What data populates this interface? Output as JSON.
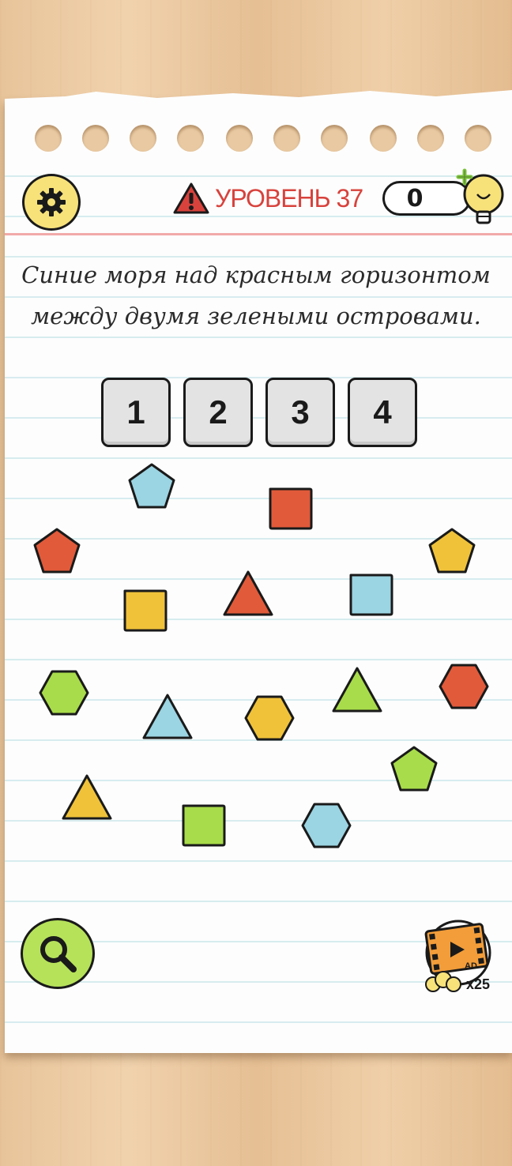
{
  "header": {
    "level_label": "УРОВЕНЬ 37",
    "hint_count": "0"
  },
  "question": {
    "line1": "Синие моря над красным горизонтом",
    "line2": "между двумя зелеными островами."
  },
  "answer_keys": [
    "1",
    "2",
    "3",
    "4"
  ],
  "shapes": [
    {
      "kind": "pentagon",
      "color": "blue"
    },
    {
      "kind": "square",
      "color": "red"
    },
    {
      "kind": "pentagon",
      "color": "red"
    },
    {
      "kind": "pentagon",
      "color": "yellow"
    },
    {
      "kind": "square",
      "color": "yellow"
    },
    {
      "kind": "triangle",
      "color": "red"
    },
    {
      "kind": "square",
      "color": "blue"
    },
    {
      "kind": "hexagon",
      "color": "green"
    },
    {
      "kind": "triangle",
      "color": "green"
    },
    {
      "kind": "hexagon",
      "color": "red"
    },
    {
      "kind": "triangle",
      "color": "blue"
    },
    {
      "kind": "hexagon",
      "color": "yellow"
    },
    {
      "kind": "pentagon",
      "color": "green"
    },
    {
      "kind": "triangle",
      "color": "yellow"
    },
    {
      "kind": "square",
      "color": "green"
    },
    {
      "kind": "hexagon",
      "color": "blue"
    }
  ],
  "colors": {
    "blue": "#9bd4e2",
    "red": "#e15a3a",
    "yellow": "#f0c23a",
    "green": "#a8dc4a",
    "level_red": "#d8423c",
    "outline": "#1a1a1a"
  },
  "footer": {
    "ad_multiplier": "x25"
  },
  "icons": [
    "gear-icon",
    "warning-icon",
    "lightbulb-icon",
    "search-icon",
    "video-ad-icon"
  ]
}
